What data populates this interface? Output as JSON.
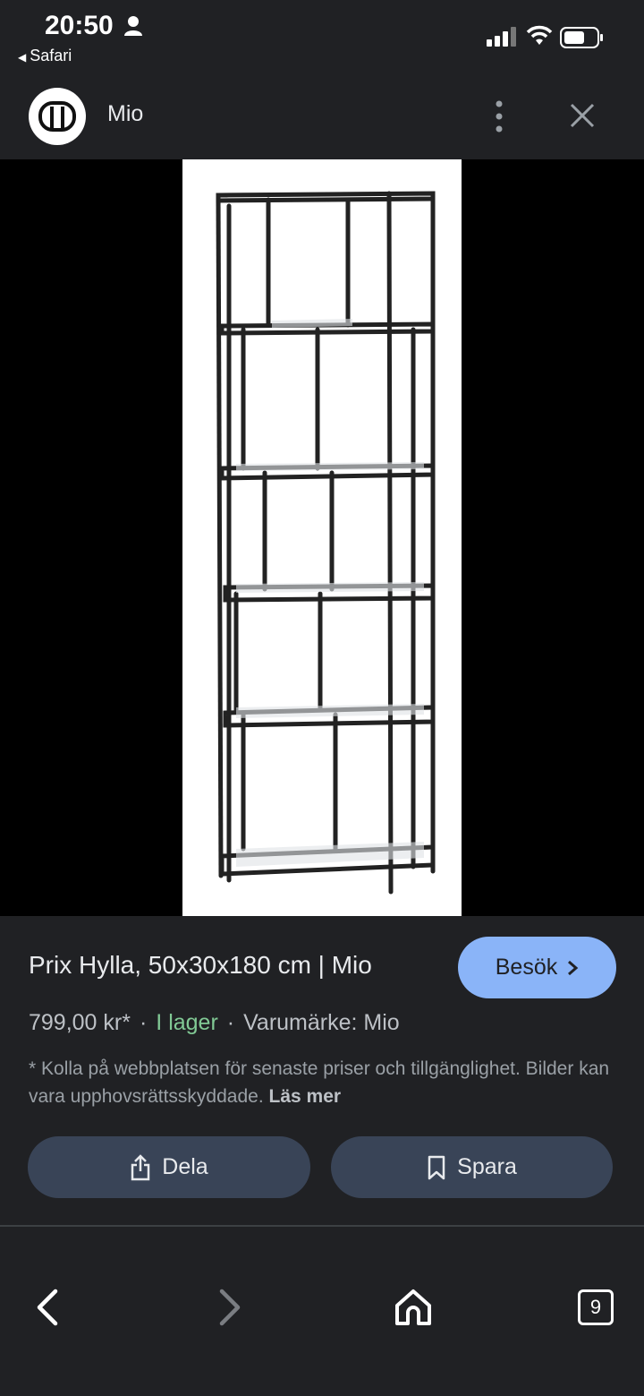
{
  "status_bar": {
    "time": "20:50",
    "back_app": "Safari"
  },
  "header": {
    "site_name": "Mio",
    "logo_icon": "mio-logo-icon",
    "more_icon": "more-vertical-icon",
    "close_icon": "close-icon"
  },
  "product": {
    "title": "Prix Hylla, 50x30x180 cm | Mio",
    "visit_label": "Besök",
    "price": "799,00 kr*",
    "stock": "I lager",
    "brand": "Varumärke: Mio",
    "disclaimer": "* Kolla på webbplatsen för senaste priser och tillgänglighet. Bilder kan vara upphovsrättsskyddade.",
    "read_more": "Läs mer",
    "share_label": "Dela",
    "save_label": "Spara"
  },
  "toolbar": {
    "tab_count": "9"
  },
  "colors": {
    "background": "#202124",
    "accent": "#8ab4f8",
    "stock": "#81c995",
    "action_button": "#394457"
  }
}
